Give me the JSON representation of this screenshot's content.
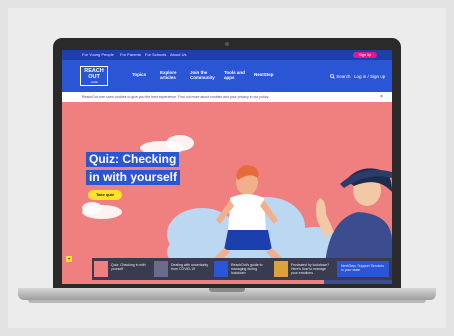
{
  "topbar": {
    "links": [
      "For Young People",
      "For Parents",
      "For Schools",
      "About Us"
    ],
    "signup": "Sign Up"
  },
  "nav": {
    "logo_main": "REACH OUT",
    "logo_sub": ".com",
    "items": [
      "Topics",
      "Explore articles",
      "Join the Community",
      "Tools and apps",
      "NextStep"
    ],
    "search": "Search",
    "login": "Log in / Sign up"
  },
  "notice": {
    "text": "ReachOut.com uses cookies to give you the best experience. Find out more about cookies and your privacy in our policy."
  },
  "hero": {
    "line1": "Quiz: Checking",
    "line2": "in with yourself",
    "button": "Take quiz"
  },
  "cards": [
    {
      "text": "Quiz: Checking in with yourself"
    },
    {
      "text": "Dealing with uncertainty from COVID-19"
    },
    {
      "text": "ReachOut's guide to managing during lockdown"
    },
    {
      "text": "Frustrated by lockdown? Here's how to manage your emotions"
    },
    {
      "text": "NextStep: Support Services in your state"
    }
  ],
  "colors": {
    "brand_blue": "#2a56d6",
    "hero_bg": "#f07f7f",
    "accent_yellow": "#ffe22a",
    "signup_pink": "#e1188f"
  }
}
